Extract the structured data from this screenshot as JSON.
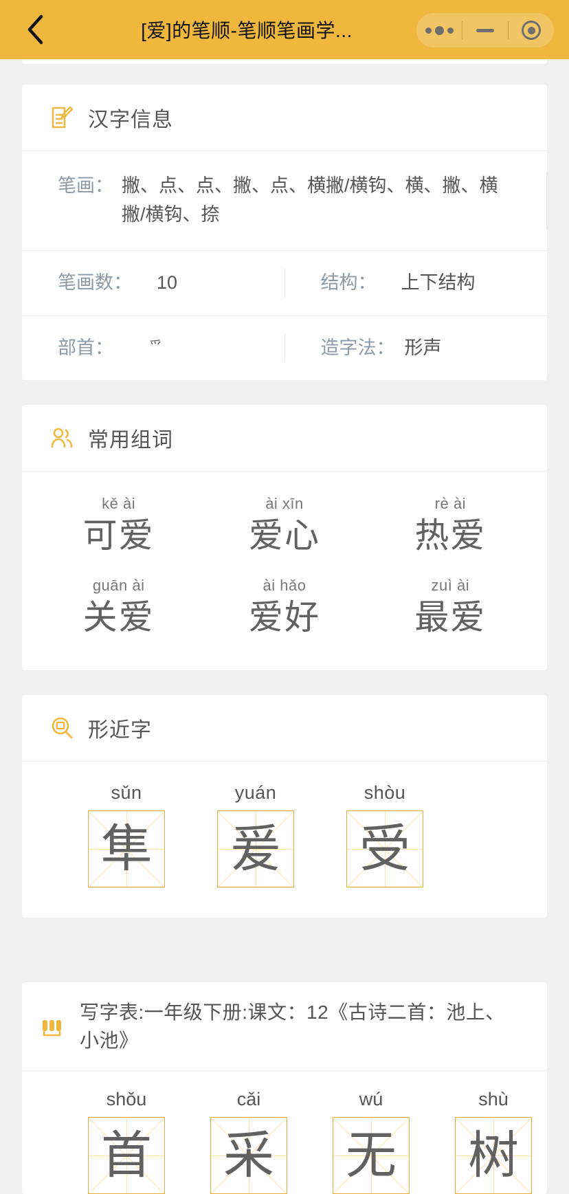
{
  "header": {
    "back_icon": "chevron-left-icon",
    "title": "[爱]的笔顺-笔顺笔画学...",
    "capsule": {
      "more_icon": "more-dots-icon",
      "minimize_icon": "minimize-dash-icon",
      "target_icon": "target-circle-icon"
    },
    "color": "#efb73e"
  },
  "info_card": {
    "icon": "document-edit-icon",
    "title": "汉字信息",
    "stroke_label": "笔画：",
    "stroke_value": "撇、点、点、撇、点、横撇/横钩、横、撇、横撇/横钩、捺",
    "rows": [
      {
        "left_label": "笔画数：",
        "left_value": "10",
        "right_label": "结构：",
        "right_value": "上下结构"
      },
      {
        "left_label": "部首：",
        "left_value": "爫",
        "right_label": "造字法：",
        "right_value": "形声"
      }
    ]
  },
  "words_card": {
    "icon": "users-icon",
    "title": "常用组词",
    "words": [
      {
        "pinyin": "kě ài",
        "hanzi": "可爱"
      },
      {
        "pinyin": "ài xīn",
        "hanzi": "爱心"
      },
      {
        "pinyin": "rè ài",
        "hanzi": "热爱"
      },
      {
        "pinyin": "guān ài",
        "hanzi": "关爱"
      },
      {
        "pinyin": "ài hǎo",
        "hanzi": "爱好"
      },
      {
        "pinyin": "zuì ài",
        "hanzi": "最爱"
      }
    ]
  },
  "similar_card": {
    "icon": "magnifier-icon",
    "title": "形近字",
    "chars": [
      {
        "pinyin": "sǔn",
        "hanzi": "隼"
      },
      {
        "pinyin": "yuán",
        "hanzi": "爰"
      },
      {
        "pinyin": "shòu",
        "hanzi": "受"
      }
    ]
  },
  "lesson_card": {
    "icon": "books-icon",
    "title": "写字表:一年级下册:课文：12《古诗二首：池上、小池》",
    "chars": [
      {
        "pinyin": "shǒu",
        "hanzi": "首"
      },
      {
        "pinyin": "cǎi",
        "hanzi": "采"
      },
      {
        "pinyin": "wú",
        "hanzi": "无"
      },
      {
        "pinyin": "shù",
        "hanzi": "树"
      }
    ]
  },
  "colors": {
    "accent": "#efb73e",
    "grid_line": "#fbe3b0",
    "page_bg": "#f0f0f0"
  }
}
